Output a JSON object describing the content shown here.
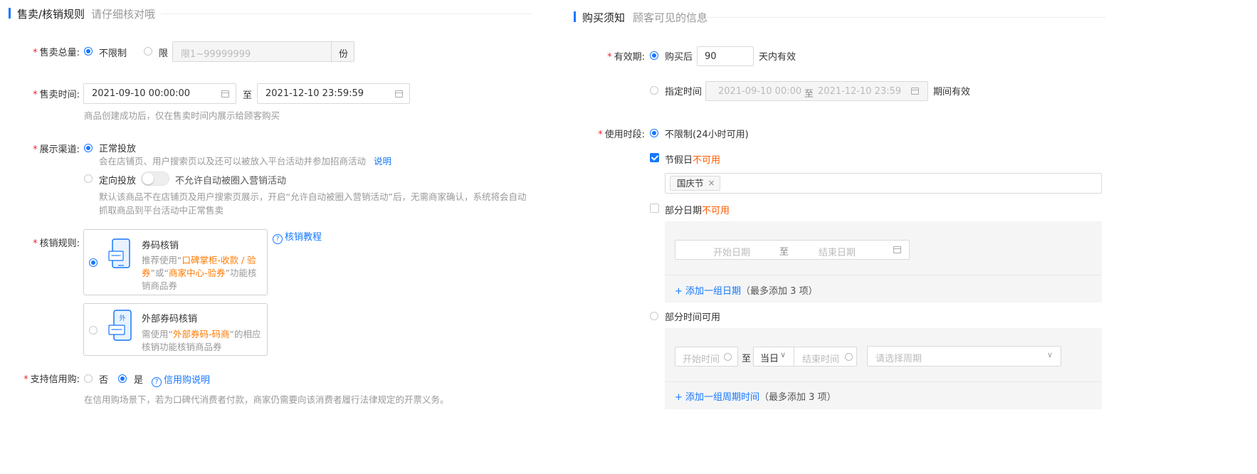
{
  "left": {
    "header": {
      "title": "售卖/核销规则",
      "subtitle": "请仔细核对哦"
    },
    "sale_total": {
      "label": "售卖总量:",
      "unlimited": "不限制",
      "limited": "限",
      "placeholder": "限1~99999999",
      "unit": "份"
    },
    "sale_time": {
      "label": "售卖时间:",
      "start": "2021-09-10 00:00:00",
      "to": "至",
      "end": "2021-12-10 23:59:59",
      "hint": "商品创建成功后，仅在售卖时间内展示给顾客购买"
    },
    "channel": {
      "label": "展示渠道:",
      "normal": "正常投放",
      "normal_desc": "会在店铺页、用户搜索页以及还可以被放入平台活动并参加招商活动",
      "explain_link": "说明",
      "targeted": "定向投放",
      "toggle_text": "不允许自动被圈入营销活动",
      "targeted_desc_1": "默认该商品不在店铺页及用户搜索页展示，开启“允许自动被圈入营销活动”后，无需商家确认，系统将会自动",
      "targeted_desc_2": "抓取商品到平台活动中正常售卖"
    },
    "verify": {
      "label": "核销规则:",
      "tutorial": "核销教程",
      "coupon_title": "券码核销",
      "coupon_desc_1_a": "推荐使用“",
      "coupon_desc_1_b": "口碑掌柜-收款 / 验",
      "coupon_desc_2_a": "券",
      "coupon_desc_2_b": "”或“",
      "coupon_desc_2_c": "商家中心-验券",
      "coupon_desc_2_d": "”功能核",
      "coupon_desc_3": "销商品券",
      "external_title": "外部券码核销",
      "external_icon_text": "外",
      "external_desc_1_a": "需使用“",
      "external_desc_1_b": "外部券码-码商",
      "external_desc_1_c": "”的相应",
      "external_desc_2": "核销功能核销商品券"
    },
    "credit": {
      "label": "支持信用购:",
      "no": "否",
      "yes": "是",
      "link": "信用购说明",
      "hint": "在信用购场景下，若为口碑代消费者付款，商家仍需要向该消费者履行法律规定的开票义务。"
    }
  },
  "right": {
    "header": {
      "title": "购买须知",
      "subtitle": "顾客可见的信息"
    },
    "validity": {
      "label": "有效期:",
      "after_purchase": "购买后",
      "days": "90",
      "days_suffix": "天内有效",
      "specified": "指定时间",
      "range_start": "2021-09-10 00:00",
      "range_to": "至",
      "range_end": "2021-12-10 23:59",
      "period_suffix": "期间有效"
    },
    "usage": {
      "label": "使用时段:",
      "unlimited": "不限制(24小时可用)",
      "holiday": "节假日",
      "unavailable": "不可用",
      "holiday_tag": "国庆节",
      "partial_dates": "部分日期",
      "start_date": "开始日期",
      "to": "至",
      "end_date": "结束日期",
      "add_date_group": "+ 添加一组日期",
      "max_note": "（最多添加 3 项）",
      "partial_time": "部分时间可用",
      "start_time": "开始时间",
      "same_day": "当日",
      "end_time": "结束时间",
      "cycle_placeholder": "请选择周期",
      "add_cycle_group": "+ 添加一组周期时间"
    }
  },
  "colors": {
    "accent": "#1677ff",
    "required": "#f5222d",
    "highlight": "#ff7a00"
  }
}
